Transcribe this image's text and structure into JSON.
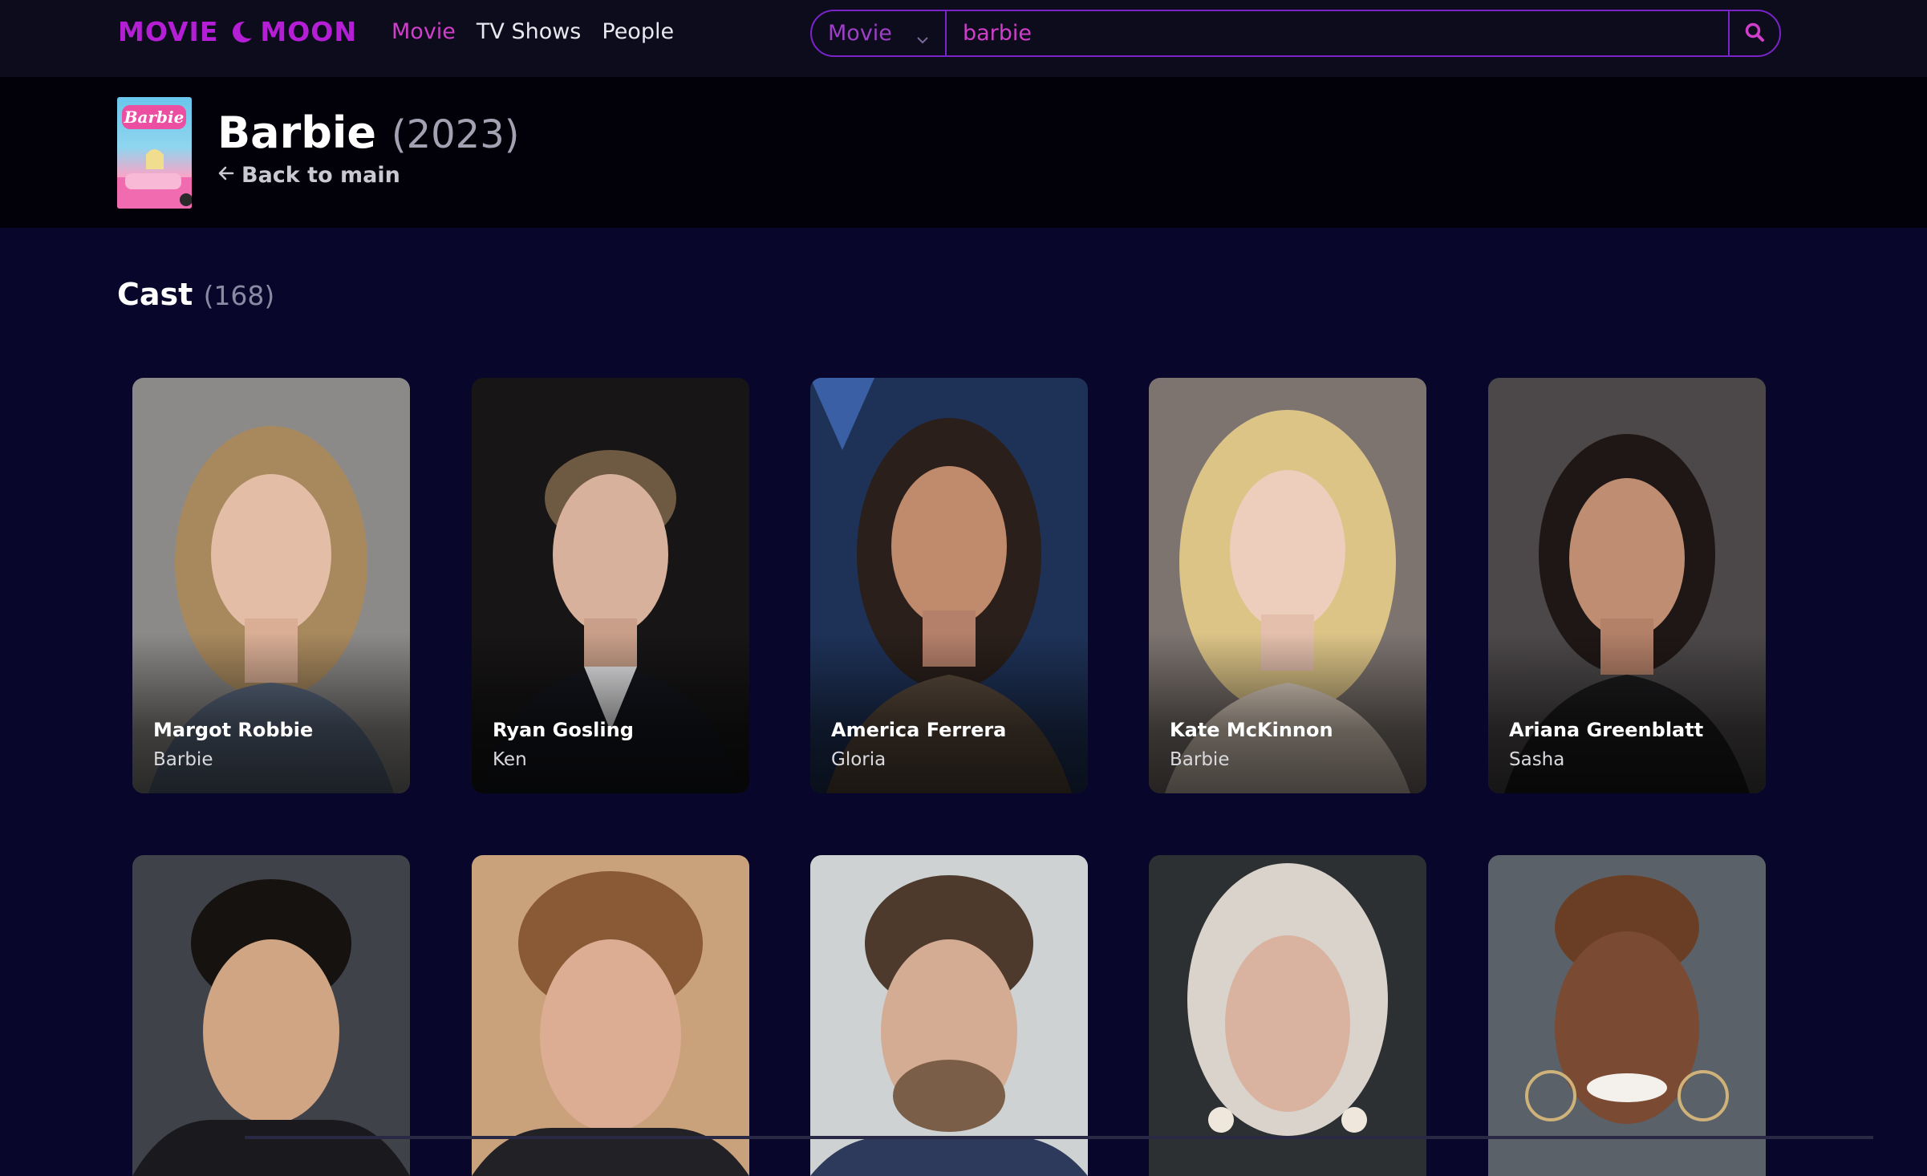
{
  "nav": {
    "logo_left": "MOVIE",
    "logo_right": "MOON",
    "links": [
      "Movie",
      "TV Shows",
      "People"
    ],
    "active_link": "Movie",
    "search": {
      "category": "Movie",
      "query": "barbie"
    }
  },
  "movie": {
    "poster_text": "Barbie",
    "title": "Barbie",
    "year": "(2023)",
    "back_label": "Back to main"
  },
  "cast": {
    "heading": "Cast",
    "count": "(168)",
    "members": [
      {
        "name": "Margot Robbie",
        "role": "Barbie"
      },
      {
        "name": "Ryan Gosling",
        "role": "Ken"
      },
      {
        "name": "America Ferrera",
        "role": "Gloria"
      },
      {
        "name": "Kate McKinnon",
        "role": "Barbie"
      },
      {
        "name": "Ariana Greenblatt",
        "role": "Sasha"
      }
    ]
  },
  "colors": {
    "accent": "#b41fd6",
    "active_link": "#d03fc9",
    "page_bg": "#08062a",
    "navbar_bg": "#0d0c1d",
    "header_bg": "#02010a"
  }
}
